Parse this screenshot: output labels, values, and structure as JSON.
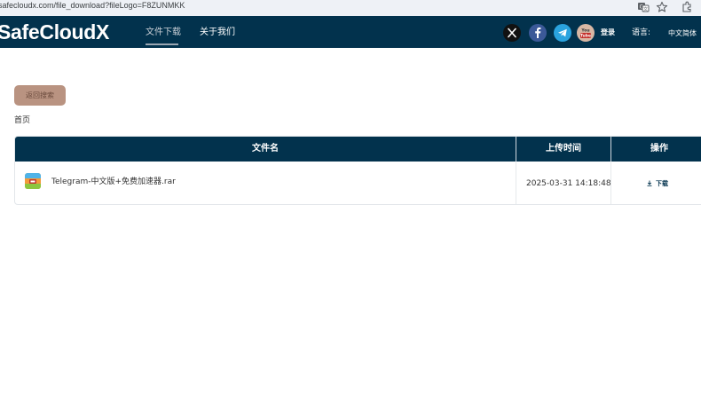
{
  "browser": {
    "url": "safecloudx.com/file_download?fileLogo=F8ZUNMKK",
    "icons": [
      "translate-icon",
      "star-icon",
      "extensions-icon"
    ]
  },
  "header": {
    "logo": "SafeCloudX",
    "nav": [
      {
        "label": "文件下载",
        "active": true
      },
      {
        "label": "关于我们",
        "active": false
      }
    ],
    "social": [
      {
        "name": "x-icon",
        "color": "#111111"
      },
      {
        "name": "facebook-icon",
        "color": "#3b5998"
      },
      {
        "name": "telegram-icon",
        "color": "#2aa3df"
      },
      {
        "name": "youtube-icon",
        "color": "#c4302b"
      }
    ],
    "youtube_text": "You Tube",
    "login": "登录",
    "language_label": "语言:",
    "language_value": "中文简体",
    "bg_color": "#02324d"
  },
  "main": {
    "back_button": "返回搜索",
    "breadcrumb": "首页",
    "table": {
      "columns": [
        "文件名",
        "上传时间",
        "操作"
      ],
      "rows": [
        {
          "file_name": "Telegram-中文版+免费加速器.rar",
          "upload_time": "2025-03-31 14:18:48",
          "action": "下载"
        }
      ]
    }
  }
}
